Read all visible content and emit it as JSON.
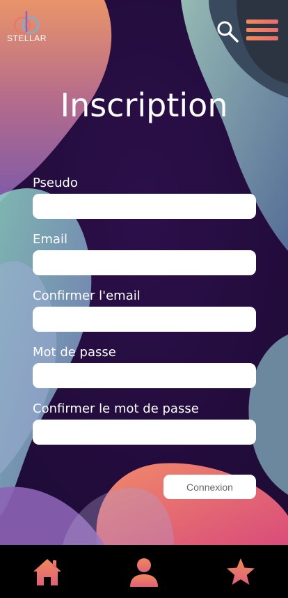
{
  "header": {
    "logo_text": "STELLAR",
    "logo_icon": "stellar-logo",
    "search_icon": "search-icon",
    "menu_icon": "hamburger-menu-icon"
  },
  "page": {
    "title": "Inscription"
  },
  "form": {
    "fields": [
      {
        "label": "Pseudo",
        "value": "",
        "placeholder": ""
      },
      {
        "label": "Email",
        "value": "",
        "placeholder": ""
      },
      {
        "label": "Confirmer l'email",
        "value": "",
        "placeholder": ""
      },
      {
        "label": "Mot de passe",
        "value": "",
        "placeholder": ""
      },
      {
        "label": "Confirmer le mot de passe",
        "value": "",
        "placeholder": ""
      }
    ],
    "connexion_label": "Connexion"
  },
  "navbar": {
    "items": [
      {
        "icon": "home-icon"
      },
      {
        "icon": "user-icon"
      },
      {
        "icon": "star-icon"
      }
    ]
  },
  "colors": {
    "accent_start": "#f08a5a",
    "accent_end": "#e86d6d",
    "background_dark": "#2a1245",
    "navbar": "#000000"
  }
}
